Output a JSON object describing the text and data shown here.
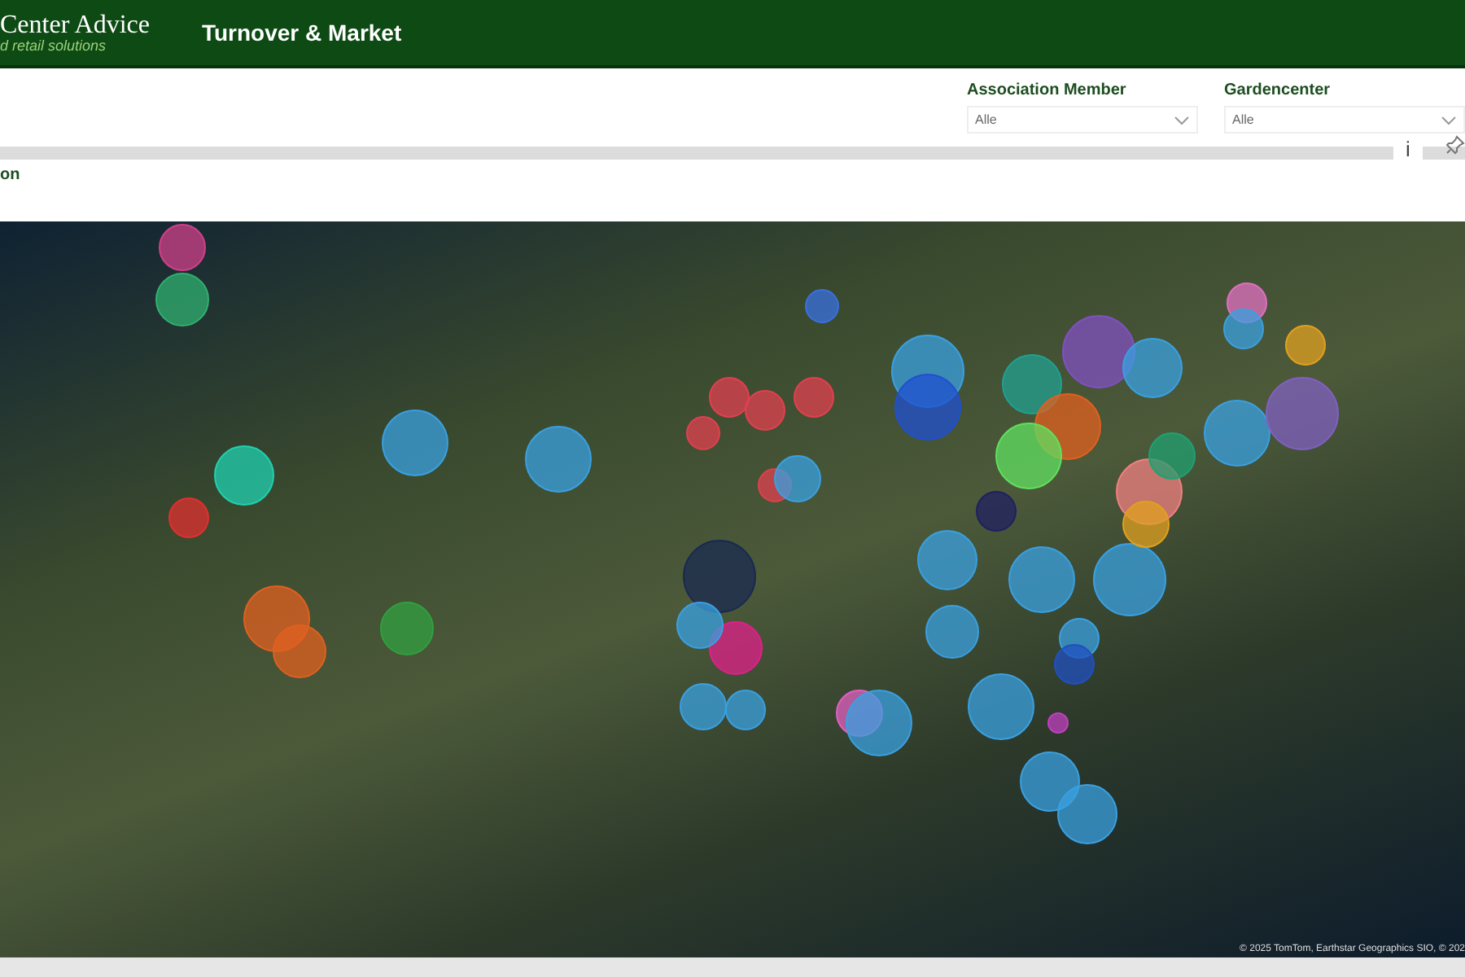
{
  "header": {
    "logo": "Center Advice",
    "tagline": "d retail solutions",
    "title": "Turnover & Market"
  },
  "filters": [
    {
      "label": "Association Member",
      "value": "Alle"
    },
    {
      "label": "Gardencenter",
      "value": "Alle"
    }
  ],
  "info_button": "i",
  "visual": {
    "title": "on",
    "attribution": "© 2025 TomTom, Earthstar Geographics SIO, © 202"
  }
}
